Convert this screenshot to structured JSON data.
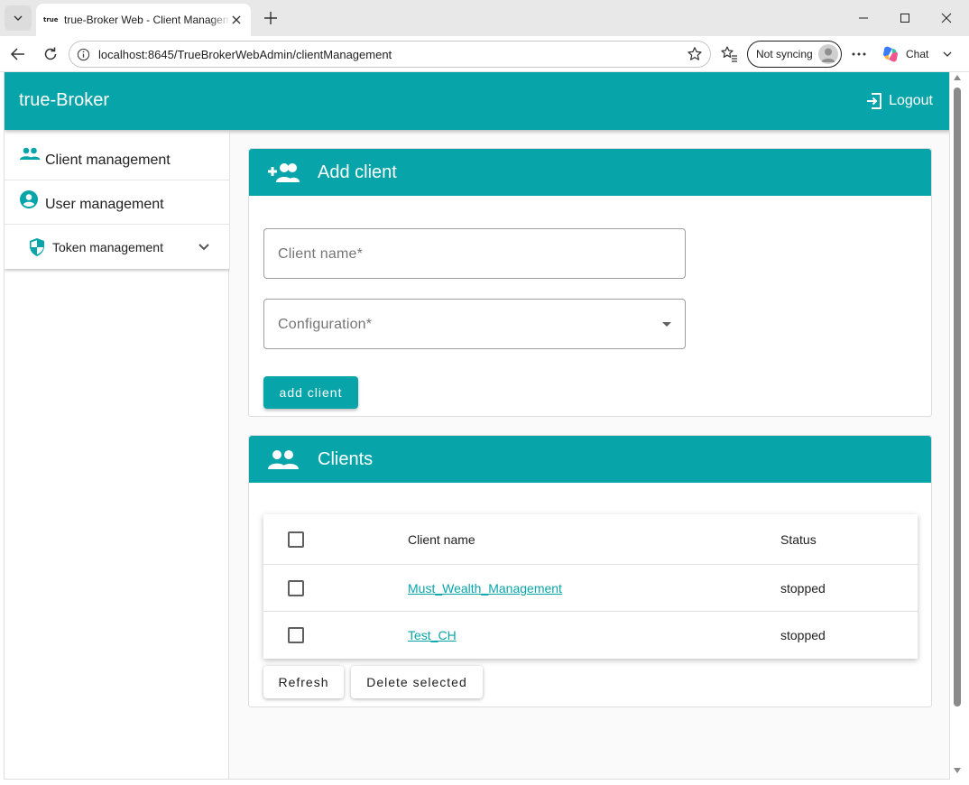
{
  "browser": {
    "tab_title": "true-Broker Web - Client Management",
    "tab_favicon_text": "true",
    "url": "localhost:8645/TrueBrokerWebAdmin/clientManagement",
    "profile_label": "Not syncing",
    "chat_label": "Chat",
    "icons": [
      "tab-list-icon",
      "close-icon",
      "plus-icon",
      "minimize-icon",
      "maximize-icon",
      "close-window-icon",
      "back-arrow-icon",
      "refresh-icon",
      "info-icon",
      "star-icon",
      "favorites-icon",
      "more-icon",
      "copilot-icon",
      "chevron-down-icon"
    ]
  },
  "app": {
    "brand": "true-Broker",
    "logout_label": "Logout",
    "accent_color": "#07a5aa"
  },
  "sidebar": {
    "items": [
      {
        "label": "Client management",
        "icon": "people-icon"
      },
      {
        "label": "User management",
        "icon": "account-circle-icon"
      },
      {
        "label": "Token management",
        "icon": "shield-icon",
        "expandable": true
      }
    ]
  },
  "add_client": {
    "title": "Add client",
    "client_name_placeholder": "Client name*",
    "configuration_placeholder": "Configuration*",
    "submit_label": "add client"
  },
  "clients": {
    "title": "Clients",
    "columns": [
      "Client name",
      "Status"
    ],
    "rows": [
      {
        "name": "Must_Wealth_Management",
        "status": "stopped"
      },
      {
        "name": "Test_CH",
        "status": "stopped"
      }
    ],
    "refresh_label": "Refresh",
    "delete_label": "Delete selected"
  }
}
